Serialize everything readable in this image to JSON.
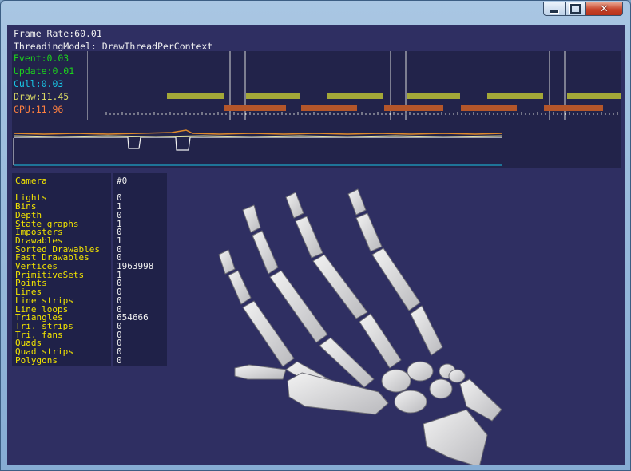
{
  "window": {
    "buttons": {
      "minimize": "minimize-icon",
      "maximize": "maximize-icon",
      "close": "close-icon"
    }
  },
  "colors": {
    "background": "#2f2f62",
    "panel": "#22234a",
    "event": "#1cd21c",
    "update": "#1cd21c",
    "cull": "#19c6e6",
    "draw": "#d7d764",
    "gpu": "#ff8040",
    "bar_draw": "#a4a838",
    "bar_gpu": "#b4562a"
  },
  "stats": {
    "frame_rate": "Frame Rate:60.01",
    "threading_model": "ThreadingModel: DrawThreadPerContext",
    "event": "Event:0.03",
    "update": "Update:0.01",
    "cull": "Cull:0.03",
    "draw": "Draw:11.45",
    "gpu": "GPU:11.96"
  },
  "scene": {
    "rows": [
      {
        "label": "Camera",
        "value": "#0"
      },
      {
        "label": "",
        "value": ""
      },
      {
        "label": "Lights",
        "value": "0"
      },
      {
        "label": "Bins",
        "value": "1"
      },
      {
        "label": "Depth",
        "value": "0"
      },
      {
        "label": "State graphs",
        "value": "1"
      },
      {
        "label": "Imposters",
        "value": "0"
      },
      {
        "label": "Drawables",
        "value": "1"
      },
      {
        "label": "Sorted Drawables",
        "value": "0"
      },
      {
        "label": "Fast Drawables",
        "value": "0"
      },
      {
        "label": "Vertices",
        "value": "1963998"
      },
      {
        "label": "PrimitiveSets",
        "value": "1"
      },
      {
        "label": "Points",
        "value": "0"
      },
      {
        "label": "Lines",
        "value": "0"
      },
      {
        "label": "Line strips",
        "value": "0"
      },
      {
        "label": "Line loops",
        "value": "0"
      },
      {
        "label": "Triangles",
        "value": "654666"
      },
      {
        "label": "Tri. strips",
        "value": "0"
      },
      {
        "label": "Tri. fans",
        "value": "0"
      },
      {
        "label": "Quads",
        "value": "0"
      },
      {
        "label": "Quad strips",
        "value": "0"
      },
      {
        "label": "Polygons",
        "value": "0"
      }
    ]
  }
}
